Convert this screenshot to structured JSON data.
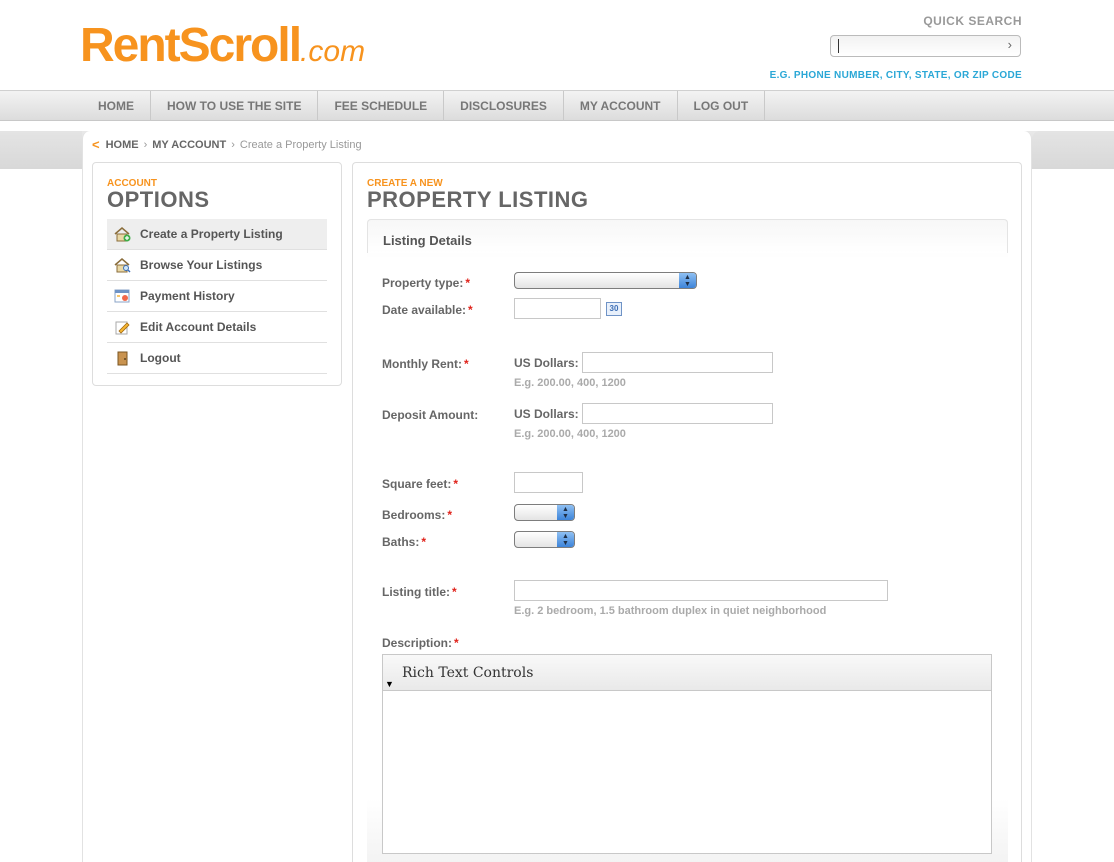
{
  "brand": {
    "logo_main": "RentScroll",
    "logo_suffix": ".com",
    "accent": "#f7931e",
    "hint_color": "#2aa7d6",
    "required_color": "#e0231b"
  },
  "quick_search": {
    "label": "QUICK SEARCH",
    "value": "",
    "go_icon": "chevron-right-icon",
    "hint": "E.G. PHONE NUMBER, CITY, STATE, OR ZIP CODE"
  },
  "nav": {
    "items": [
      "HOME",
      "HOW TO USE THE SITE",
      "FEE SCHEDULE",
      "DISCLOSURES",
      "MY ACCOUNT",
      "LOG OUT"
    ]
  },
  "breadcrumb": {
    "back_icon": "back-arrow-icon",
    "home": "HOME",
    "account": "MY ACCOUNT",
    "current": "Create a Property Listing",
    "separator": "›"
  },
  "sidebar": {
    "kicker": "ACCOUNT",
    "title": "OPTIONS",
    "items": [
      {
        "label": "Create a Property Listing",
        "icon": "house-add-icon",
        "active": true
      },
      {
        "label": "Browse Your Listings",
        "icon": "house-search-icon",
        "active": false
      },
      {
        "label": "Payment History",
        "icon": "calendar-payment-icon",
        "active": false
      },
      {
        "label": "Edit Account Details",
        "icon": "edit-pencil-icon",
        "active": false
      },
      {
        "label": "Logout",
        "icon": "door-icon",
        "active": false
      }
    ]
  },
  "main": {
    "kicker": "CREATE A NEW",
    "title": "PROPERTY LISTING",
    "section_title": "Listing Details",
    "required_mark": "*",
    "fields": {
      "property_type": {
        "label": "Property type:",
        "value": ""
      },
      "date_available": {
        "label": "Date available:",
        "value": "",
        "calendar_icon": "calendar-icon",
        "calendar_text": "30"
      },
      "monthly_rent": {
        "label": "Monthly Rent:",
        "currency_label": "US Dollars:",
        "value": "",
        "hint": "E.g. 200.00, 400, 1200"
      },
      "deposit": {
        "label": "Deposit Amount:",
        "currency_label": "US Dollars:",
        "value": "",
        "hint": "E.g. 200.00, 400, 1200"
      },
      "square_feet": {
        "label": "Square feet:",
        "value": ""
      },
      "bedrooms": {
        "label": "Bedrooms:",
        "value": ""
      },
      "baths": {
        "label": "Baths:",
        "value": ""
      },
      "listing_title": {
        "label": "Listing title:",
        "value": "",
        "hint": "E.g. 2 bedroom, 1.5 bathroom duplex in quiet neighborhood"
      },
      "description": {
        "label": "Description:",
        "toggle": "▼",
        "toolbar_label": "Rich Text Controls",
        "value": ""
      }
    }
  }
}
